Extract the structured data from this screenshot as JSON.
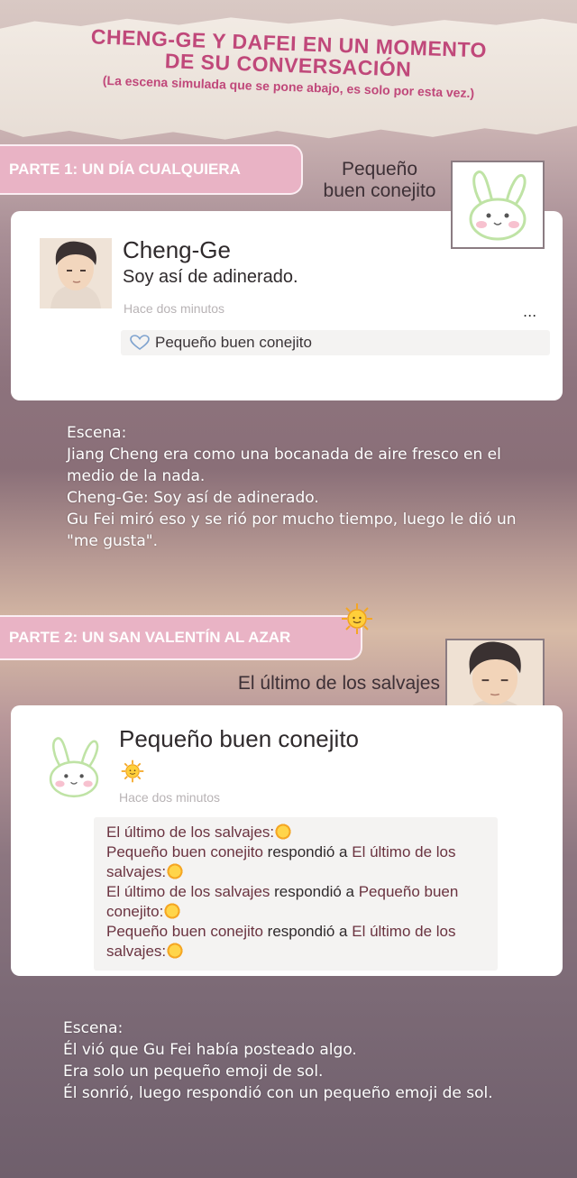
{
  "banner": {
    "title_line1": "CHENG-GE Y DAFEI EN UN MOMENTO",
    "title_line2": "DE SU CONVERSACIÓN",
    "subtitle": "(La escena simulada que se pone abajo, es solo por esta vez.)"
  },
  "part1": {
    "tag": "PARTE 1: UN DÍA CUALQUIERA",
    "side_name_line1": "Pequeño",
    "side_name_line2": "buen conejito",
    "post": {
      "name": "Cheng-Ge",
      "text": "Soy así de adinerado.",
      "time": "Hace dos minutos",
      "more": "...",
      "like_name": "Pequeño buen conejito"
    },
    "scene": [
      "Escena:",
      "Jiang Cheng era como una bocanada de aire fresco en el medio de la nada.",
      "Cheng-Ge: Soy así de adinerado.",
      "Gu Fei miró eso y se rió por mucho tiempo, luego le dió un \"me gusta\"."
    ]
  },
  "part2": {
    "tag": "PARTE 2: UN SAN VALENTÍN AL AZAR",
    "side_name": "El último de los salvajes",
    "post": {
      "name": "Pequeño buen conejito",
      "time": "Hace dos minutos"
    },
    "comments": {
      "c1_name": "El último de los salvajes:",
      "c2_from": "Pequeño buen conejito",
      "c2_verb": " respondió a ",
      "c2_to": "El último de los salvajes:",
      "c3_from": "El último de los salvajes",
      "c3_verb": " respondió a ",
      "c3_to": "Pequeño buen conejito:",
      "c4_from": "Pequeño buen conejito",
      "c4_verb": " respondió a ",
      "c4_to": "El último de los salvajes:"
    },
    "scene": [
      "Escena:",
      "Él vió que Gu Fei había posteado algo.",
      "Era solo un pequeño emoji de sol.",
      "Él sonrió, luego respondió con un pequeño emoji de sol."
    ]
  },
  "icons": [
    "sun-icon",
    "heart-outline-icon",
    "bunny-avatar-icon",
    "man-avatar-icon"
  ]
}
